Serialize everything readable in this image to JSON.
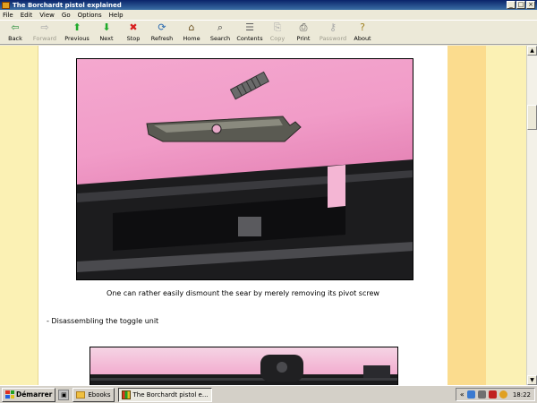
{
  "window": {
    "title": "The Borchardt pistol explained",
    "controls": [
      "_",
      "□",
      "×"
    ]
  },
  "menu": [
    "File",
    "Edit",
    "View",
    "Go",
    "Options",
    "Help"
  ],
  "toolbar": [
    {
      "label": "Back",
      "icon": "back-arrow-icon",
      "glyph": "⇦",
      "color": "#2a8f3a",
      "enabled": true
    },
    {
      "label": "Forward",
      "icon": "forward-arrow-icon",
      "glyph": "⇨",
      "color": "#a8a8a8",
      "enabled": false
    },
    {
      "label": "Previous",
      "icon": "up-arrow-icon",
      "glyph": "⬆",
      "color": "#1faa2a",
      "enabled": true
    },
    {
      "label": "Next",
      "icon": "down-arrow-icon",
      "glyph": "⬇",
      "color": "#1faa2a",
      "enabled": true
    },
    {
      "label": "Stop",
      "icon": "stop-icon",
      "glyph": "✖",
      "color": "#d81e1e",
      "enabled": true
    },
    {
      "label": "Refresh",
      "icon": "refresh-icon",
      "glyph": "⟳",
      "color": "#2a6ab0",
      "enabled": true
    },
    {
      "label": "Home",
      "icon": "home-icon",
      "glyph": "⌂",
      "color": "#6a5020",
      "enabled": true
    },
    {
      "label": "Search",
      "icon": "search-icon",
      "glyph": "⌕",
      "color": "#404040",
      "enabled": true
    },
    {
      "label": "Contents",
      "icon": "contents-icon",
      "glyph": "☰",
      "color": "#606060",
      "enabled": true
    },
    {
      "label": "Copy",
      "icon": "copy-icon",
      "glyph": "⎘",
      "color": "#a8a8a8",
      "enabled": false
    },
    {
      "label": "Print",
      "icon": "print-icon",
      "glyph": "⎙",
      "color": "#505050",
      "enabled": true
    },
    {
      "label": "Password",
      "icon": "key-icon",
      "glyph": "⚷",
      "color": "#a8a8a8",
      "enabled": false
    },
    {
      "label": "About",
      "icon": "about-icon",
      "glyph": "?",
      "color": "#a08020",
      "enabled": true
    }
  ],
  "content": {
    "caption": "One can rather easily dismount the sear by merely removing its pivot screw",
    "section_heading": "- Disassembling the toggle unit",
    "colors": {
      "stripe_light": "#fbf1b4",
      "stripe_dark": "#fbdc8e",
      "photo_bg": "#f19cc8"
    }
  },
  "taskbar": {
    "start_label": "Démarrer",
    "tasks": [
      {
        "label": "Ebooks",
        "icon": "folder-icon",
        "active": false
      },
      {
        "label": "The Borchardt pistol e...",
        "icon": "app-icon",
        "active": true
      }
    ],
    "tray_expand": "«",
    "time": "18:22"
  }
}
